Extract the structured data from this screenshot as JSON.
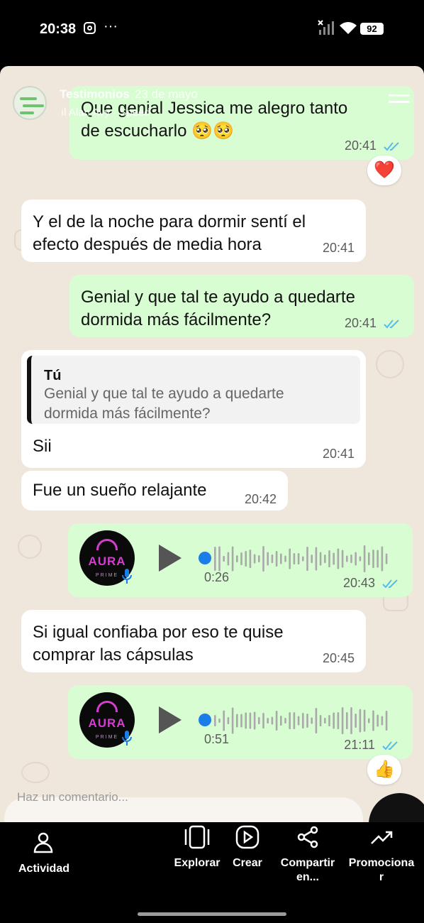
{
  "status_bar": {
    "time": "20:38",
    "dots": "···",
    "battery": "92"
  },
  "story": {
    "title": "Testimonios",
    "date": "23 de mayo",
    "music": "Alan Avy · Speed",
    "comment_placeholder": "Haz un comentario..."
  },
  "chat": {
    "messages": [
      {
        "dir": "out",
        "text_lines": [
          "Que genial Jessica me alegro tanto",
          "de escucharlo 🥺🥺"
        ],
        "time": "20:41",
        "read": true,
        "reaction": "❤️"
      },
      {
        "dir": "in",
        "text_lines": [
          "Y el de la noche para dormir sentí el",
          "efecto después de media hora"
        ],
        "time": "20:41"
      },
      {
        "dir": "out",
        "text_lines": [
          "Genial y que tal te ayudo a quedarte",
          "dormida más fácilmente?"
        ],
        "time": "20:41",
        "read": true
      },
      {
        "dir": "in",
        "quote_author": "Tú",
        "quote_lines": [
          "Genial y que tal te ayudo a quedarte",
          "dormida más fácilmente?"
        ],
        "text": "Sii",
        "time": "20:41"
      },
      {
        "dir": "in",
        "text": "Fue un sueño relajante",
        "time": "20:42"
      },
      {
        "dir": "out",
        "type": "voice",
        "duration": "0:26",
        "time": "20:43",
        "read": true
      },
      {
        "dir": "in",
        "text_lines": [
          "Si igual confiaba por eso te quise",
          "comprar las cápsulas"
        ],
        "time": "20:45"
      },
      {
        "dir": "out",
        "type": "voice",
        "duration": "0:51",
        "time": "21:11",
        "read": true,
        "reaction": "👍"
      }
    ],
    "avatar_brand": "AURA",
    "avatar_sub": "PRIME"
  },
  "bottom_bar": {
    "items": [
      {
        "label": "Actividad",
        "icon": "activity-icon"
      },
      {
        "label": "Explorar",
        "icon": "explore-icon"
      },
      {
        "label": "Crear",
        "icon": "create-icon"
      },
      {
        "label_lines": [
          "Compartir",
          "en..."
        ],
        "icon": "share-icon"
      },
      {
        "label_lines": [
          "Promociona",
          "r"
        ],
        "icon": "promote-icon"
      }
    ]
  },
  "colors": {
    "chat_bg": "#efe7dc",
    "outgoing_bubble": "#d9fdd3",
    "incoming_bubble": "#ffffff",
    "read_ticks": "#53bdeb",
    "voice_dot": "#1a7de8"
  }
}
